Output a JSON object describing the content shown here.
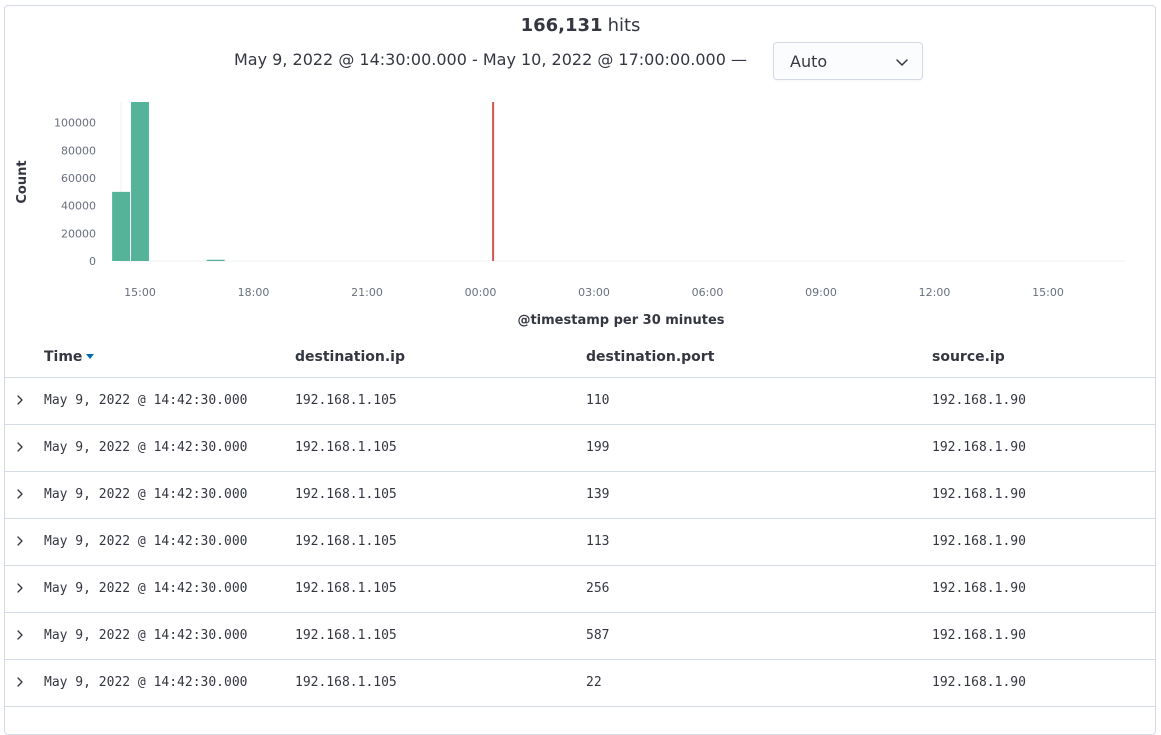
{
  "header": {
    "hits_count": "166,131",
    "hits_label": "hits",
    "time_range": "May 9, 2022 @ 14:30:00.000 - May 10, 2022 @ 17:00:00.000 —",
    "interval_value": "Auto",
    "interval_icon": "chevron-down-icon"
  },
  "chart_data": {
    "type": "bar",
    "title": "",
    "xlabel": "@timestamp per 30 minutes",
    "ylabel": "Count",
    "x_ticks": [
      "15:00",
      "18:00",
      "21:00",
      "00:00",
      "03:00",
      "06:00",
      "09:00",
      "12:00",
      "15:00"
    ],
    "y_ticks": [
      "0",
      "20000",
      "40000",
      "60000",
      "80000",
      "100000"
    ],
    "ylim": [
      0,
      115000
    ],
    "series": [
      {
        "color": "#54b399",
        "points": [
          {
            "x": "May 9, 2022 14:30",
            "y": 50000
          },
          {
            "x": "May 9, 2022 15:00",
            "y": 115000
          },
          {
            "x": "May 9, 2022 17:00",
            "y": 900
          }
        ]
      }
    ],
    "now_marker": {
      "x": "May 10, 2022 00:20",
      "color": "#d4544f"
    },
    "grid": false
  },
  "table": {
    "columns": [
      "Time",
      "destination.ip",
      "destination.port",
      "source.ip"
    ],
    "sort_icon": "sort-down-icon",
    "expand_icon": "chevron-right-icon",
    "rows": [
      {
        "time": "May 9, 2022 @ 14:42:30.000",
        "dest_ip": "192.168.1.105",
        "dest_port": "110",
        "src_ip": "192.168.1.90"
      },
      {
        "time": "May 9, 2022 @ 14:42:30.000",
        "dest_ip": "192.168.1.105",
        "dest_port": "199",
        "src_ip": "192.168.1.90"
      },
      {
        "time": "May 9, 2022 @ 14:42:30.000",
        "dest_ip": "192.168.1.105",
        "dest_port": "139",
        "src_ip": "192.168.1.90"
      },
      {
        "time": "May 9, 2022 @ 14:42:30.000",
        "dest_ip": "192.168.1.105",
        "dest_port": "113",
        "src_ip": "192.168.1.90"
      },
      {
        "time": "May 9, 2022 @ 14:42:30.000",
        "dest_ip": "192.168.1.105",
        "dest_port": "256",
        "src_ip": "192.168.1.90"
      },
      {
        "time": "May 9, 2022 @ 14:42:30.000",
        "dest_ip": "192.168.1.105",
        "dest_port": "587",
        "src_ip": "192.168.1.90"
      },
      {
        "time": "May 9, 2022 @ 14:42:30.000",
        "dest_ip": "192.168.1.105",
        "dest_port": "22",
        "src_ip": "192.168.1.90"
      }
    ]
  }
}
